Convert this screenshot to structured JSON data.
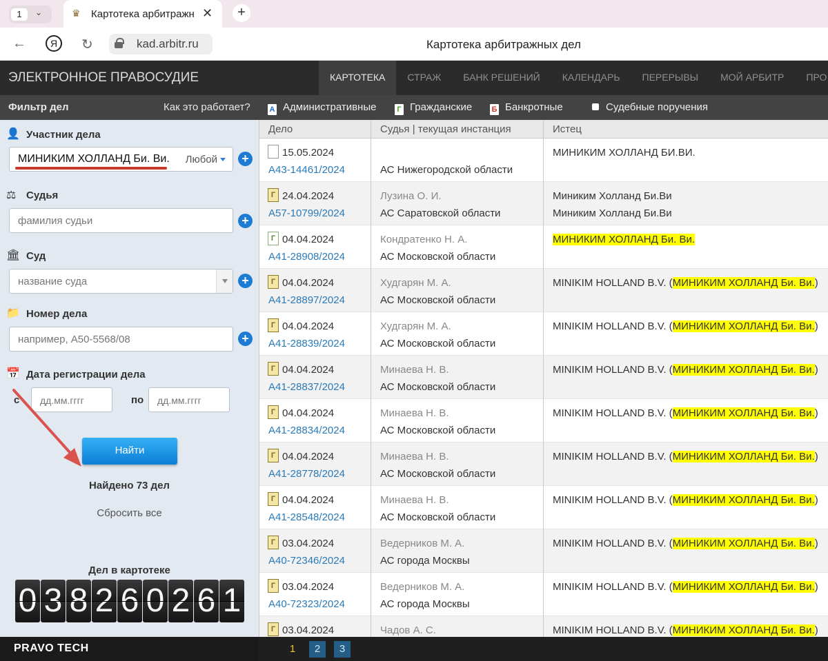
{
  "browser": {
    "tab_count": "1",
    "tab_title": "Картотека арбитражных дел",
    "url": "kad.arbitr.ru",
    "page_title": "Картотека арбитражных дел"
  },
  "header": {
    "logo": "ЭЛЕКТРОННОЕ ПРАВОСУДИЕ",
    "nav": [
      "КАРТОТЕКА",
      "СТРАЖ",
      "БАНК РЕШЕНИЙ",
      "КАЛЕНДАРЬ",
      "ПЕРЕРЫВЫ",
      "МОЙ АРБИТР",
      "ПРО"
    ]
  },
  "filterbar": {
    "title": "Фильтр дел",
    "how": "Как это работает?",
    "categories": [
      {
        "icon": "А",
        "label": "Административные",
        "color": "#1e6fd0"
      },
      {
        "icon": "Г",
        "label": "Гражданские",
        "color": "#4c9a2a"
      },
      {
        "icon": "Б",
        "label": "Банкротные",
        "color": "#d03a2a"
      }
    ],
    "court_orders": "Судебные поручения"
  },
  "sidebar": {
    "participant_label": "Участник дела",
    "participant_value": "МИНИКИМ ХОЛЛАНД Би. Ви.",
    "participant_role": "Любой",
    "judge_label": "Судья",
    "judge_placeholder": "фамилия судьи",
    "court_label": "Суд",
    "court_placeholder": "название суда",
    "caseno_label": "Номер дела",
    "caseno_placeholder": "например, А50-5568/08",
    "date_label": "Дата регистрации дела",
    "from_label": "с",
    "to_label": "по",
    "date_placeholder": "дд.мм.гггг",
    "search_button": "Найти",
    "found": "Найдено 73 дел",
    "reset": "Сбросить все",
    "in_catalog_label": "Дел в картотеке",
    "counter_digits": [
      "0",
      "3",
      "8",
      "2",
      "6",
      "0",
      "2",
      "6",
      "1"
    ]
  },
  "table": {
    "headers": [
      "Дело",
      "Судья | текущая инстанция",
      "Истец"
    ],
    "rows": [
      {
        "date": "15.05.2024",
        "case": "А43-14461/2024",
        "icon": "blank",
        "judge": "",
        "court": "АС Нижегородской области",
        "plaintiff": "МИНИКИМ ХОЛЛАНД БИ.ВИ.",
        "plaintiff_hl": "",
        "plaintiff_tail": "",
        "plaintiff2": ""
      },
      {
        "date": "24.04.2024",
        "case": "А57-10799/2024",
        "icon": "g",
        "judge": "Лузина О. И.",
        "court": "АС Саратовской области",
        "plaintiff": "Миниким Холланд Би.Ви",
        "plaintiff_hl": "",
        "plaintiff_tail": "",
        "plaintiff2": "Миниким Холланд Би.Ви"
      },
      {
        "date": "04.04.2024",
        "case": "А41-28908/2024",
        "icon": "gr",
        "judge": "Кондратенко Н. А.",
        "court": "АС Московской области",
        "plaintiff": "",
        "plaintiff_hl": "МИНИКИМ ХОЛЛАНД Би. Ви.",
        "plaintiff_tail": "",
        "plaintiff2": ""
      },
      {
        "date": "04.04.2024",
        "case": "А41-28897/2024",
        "icon": "g",
        "judge": "Худгарян М. А.",
        "court": "АС Московской области",
        "plaintiff": "MINIKIM HOLLAND B.V. (",
        "plaintiff_hl": "МИНИКИМ ХОЛЛАНД Би. Ви.",
        "plaintiff_tail": ")",
        "plaintiff2": ""
      },
      {
        "date": "04.04.2024",
        "case": "А41-28839/2024",
        "icon": "g",
        "judge": "Худгарян М. А.",
        "court": "АС Московской области",
        "plaintiff": "MINIKIM HOLLAND B.V. (",
        "plaintiff_hl": "МИНИКИМ ХОЛЛАНД Би. Ви.",
        "plaintiff_tail": ")",
        "plaintiff2": ""
      },
      {
        "date": "04.04.2024",
        "case": "А41-28837/2024",
        "icon": "g",
        "judge": "Минаева Н. В.",
        "court": "АС Московской области",
        "plaintiff": "MINIKIM HOLLAND B.V. (",
        "plaintiff_hl": "МИНИКИМ ХОЛЛАНД Би. Ви.",
        "plaintiff_tail": ")",
        "plaintiff2": ""
      },
      {
        "date": "04.04.2024",
        "case": "А41-28834/2024",
        "icon": "g",
        "judge": "Минаева Н. В.",
        "court": "АС Московской области",
        "plaintiff": "MINIKIM HOLLAND B.V. (",
        "plaintiff_hl": "МИНИКИМ ХОЛЛАНД Би. Ви.",
        "plaintiff_tail": ")",
        "plaintiff2": ""
      },
      {
        "date": "04.04.2024",
        "case": "А41-28778/2024",
        "icon": "g",
        "judge": "Минаева Н. В.",
        "court": "АС Московской области",
        "plaintiff": "MINIKIM HOLLAND B.V. (",
        "plaintiff_hl": "МИНИКИМ ХОЛЛАНД Би. Ви.",
        "plaintiff_tail": ")",
        "plaintiff2": ""
      },
      {
        "date": "04.04.2024",
        "case": "А41-28548/2024",
        "icon": "g",
        "judge": "Минаева Н. В.",
        "court": "АС Московской области",
        "plaintiff": "MINIKIM HOLLAND B.V. (",
        "plaintiff_hl": "МИНИКИМ ХОЛЛАНД Би. Ви.",
        "plaintiff_tail": ")",
        "plaintiff2": ""
      },
      {
        "date": "03.04.2024",
        "case": "А40-72346/2024",
        "icon": "g",
        "judge": "Ведерников М. А.",
        "court": "АС города Москвы",
        "plaintiff": "MINIKIM HOLLAND B.V. (",
        "plaintiff_hl": "МИНИКИМ ХОЛЛАНД Би. Ви.",
        "plaintiff_tail": ")",
        "plaintiff2": ""
      },
      {
        "date": "03.04.2024",
        "case": "А40-72323/2024",
        "icon": "g",
        "judge": "Ведерников М. А.",
        "court": "АС города Москвы",
        "plaintiff": "MINIKIM HOLLAND B.V. (",
        "plaintiff_hl": "МИНИКИМ ХОЛЛАНД Би. Ви.",
        "plaintiff_tail": ")",
        "plaintiff2": ""
      },
      {
        "date": "03.04.2024",
        "case": "",
        "icon": "g",
        "judge": "Чадов А. С.",
        "court": "",
        "plaintiff": "MINIKIM HOLLAND B.V. (",
        "plaintiff_hl": "МИНИКИМ ХОЛЛАНД Би. Ви.",
        "plaintiff_tail": ")",
        "plaintiff2": ""
      }
    ]
  },
  "footer": {
    "brand": "PRAVO TECH",
    "pages": [
      "1",
      "2",
      "3"
    ]
  }
}
